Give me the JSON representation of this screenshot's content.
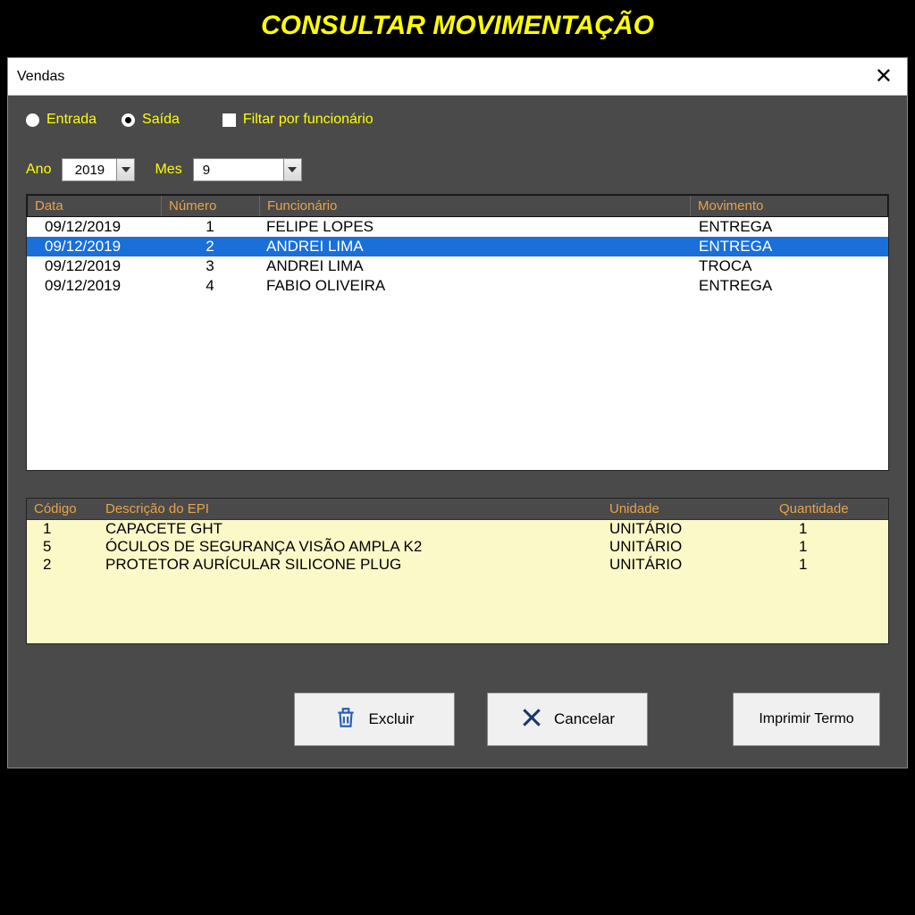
{
  "banner": {
    "title": "CONSULTAR MOVIMENTAÇÃO"
  },
  "window": {
    "title": "Vendas"
  },
  "filters": {
    "entrada_label": "Entrada",
    "saida_label": "Saída",
    "filter_employee_label": "Filtar por funcionário",
    "selected_radio": "saida"
  },
  "period": {
    "ano_label": "Ano",
    "mes_label": "Mes",
    "ano_value": "2019",
    "mes_value": "9"
  },
  "table": {
    "headers": {
      "data": "Data",
      "numero": "Número",
      "funcionario": "Funcionário",
      "movimento": "Movimento"
    },
    "rows": [
      {
        "data": "09/12/2019",
        "numero": "1",
        "funcionario": "FELIPE LOPES",
        "movimento": "ENTREGA",
        "selected": false
      },
      {
        "data": "09/12/2019",
        "numero": "2",
        "funcionario": "ANDREI LIMA",
        "movimento": "ENTREGA",
        "selected": true
      },
      {
        "data": "09/12/2019",
        "numero": "3",
        "funcionario": "ANDREI LIMA",
        "movimento": "TROCA",
        "selected": false
      },
      {
        "data": "09/12/2019",
        "numero": "4",
        "funcionario": "FABIO OLIVEIRA",
        "movimento": "ENTREGA",
        "selected": false
      }
    ]
  },
  "detail": {
    "headers": {
      "codigo": "Código",
      "descricao": "Descrição do EPI",
      "unidade": "Unidade",
      "quantidade": "Quantidade"
    },
    "rows": [
      {
        "codigo": "1",
        "descricao": "CAPACETE GHT",
        "unidade": "UNITÁRIO",
        "quantidade": "1"
      },
      {
        "codigo": "5",
        "descricao": "ÓCULOS DE SEGURANÇA VISÃO AMPLA K2",
        "unidade": "UNITÁRIO",
        "quantidade": "1"
      },
      {
        "codigo": "2",
        "descricao": "PROTETOR AURÍCULAR SILICONE PLUG",
        "unidade": "UNITÁRIO",
        "quantidade": "1"
      }
    ]
  },
  "buttons": {
    "excluir": "Excluir",
    "cancelar": "Cancelar",
    "imprimir": "Imprimir Termo"
  }
}
